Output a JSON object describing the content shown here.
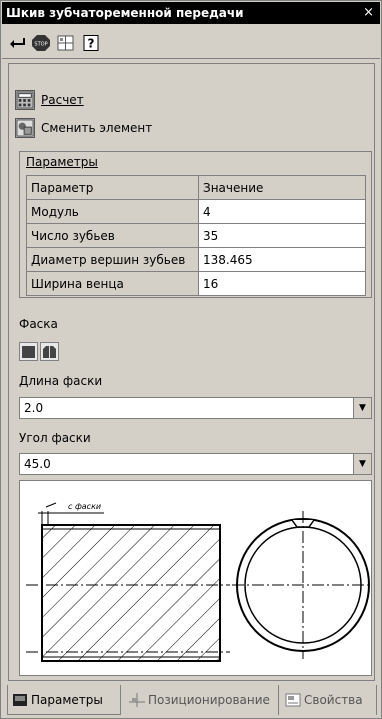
{
  "window": {
    "title": "Шкив зубчатоременной передачи",
    "close_label": "×"
  },
  "toolbar": {
    "icons": [
      "enter-icon",
      "stop-icon",
      "snap-icon",
      "help-icon"
    ]
  },
  "commands": {
    "calc": {
      "label": "Расчет",
      "icon": "calculator-icon"
    },
    "replace": {
      "label": "Сменить элемент",
      "icon": "replace-element-icon"
    }
  },
  "params": {
    "title": "Параметры",
    "columns": [
      "Параметр",
      "Значение"
    ],
    "rows": [
      {
        "name": "Модуль",
        "value": "4"
      },
      {
        "name": "Число зубьев",
        "value": "35"
      },
      {
        "name": "Диаметр вершин зубьев",
        "value": "138.465"
      },
      {
        "name": "Ширина венца",
        "value": "16"
      }
    ]
  },
  "chamfer": {
    "label": "Фаска"
  },
  "chamfer_length": {
    "label": "Длина фаски",
    "value": "2.0"
  },
  "chamfer_angle": {
    "label": "Угол фаски",
    "value": "45.0"
  },
  "drawing": {
    "annotation": "с фаски"
  },
  "tabs": [
    {
      "label": "Параметры",
      "active": true
    },
    {
      "label": "Позиционирование",
      "active": false
    },
    {
      "label": "Свойства",
      "active": false
    }
  ]
}
